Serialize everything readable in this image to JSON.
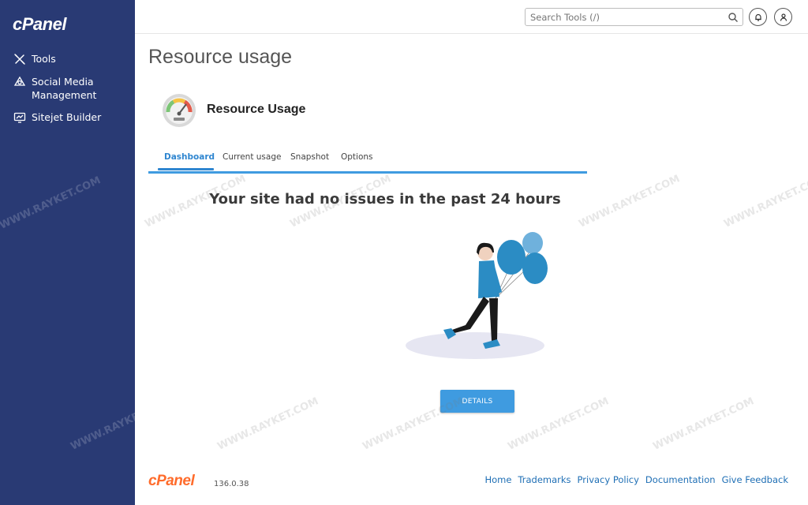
{
  "brand": {
    "logo_text": "cPanel",
    "version": "136.0.38",
    "sidebar_color": "#293a74",
    "accent_color": "#3f9be0",
    "footer_logo_color": "#ff6c2c"
  },
  "sidebar": {
    "items": [
      {
        "label": "Tools",
        "icon": "tools-icon"
      },
      {
        "label": "Social Media Management",
        "icon": "social-media-icon"
      },
      {
        "label": "Sitejet Builder",
        "icon": "sitejet-icon"
      }
    ]
  },
  "topbar": {
    "search_placeholder": "Search Tools (/)",
    "search_icon": "search-icon",
    "notifications_icon": "bell-icon",
    "user_icon": "user-icon"
  },
  "page": {
    "title": "Resource usage",
    "app_title": "Resource Usage",
    "app_icon": "speedometer-icon",
    "tabs": [
      {
        "label": "Dashboard",
        "active": true
      },
      {
        "label": "Current usage",
        "active": false
      },
      {
        "label": "Snapshot",
        "active": false
      },
      {
        "label": "Options",
        "active": false
      }
    ],
    "headline": "Your site had no issues in the past 24 hours",
    "illustration": "woman-with-balloons-illustration",
    "details_button": "DETAILS"
  },
  "footer": {
    "links": [
      "Home",
      "Trademarks",
      "Privacy Policy",
      "Documentation",
      "Give Feedback"
    ]
  },
  "watermark": {
    "text": "WWW.RAYKET.COM"
  }
}
